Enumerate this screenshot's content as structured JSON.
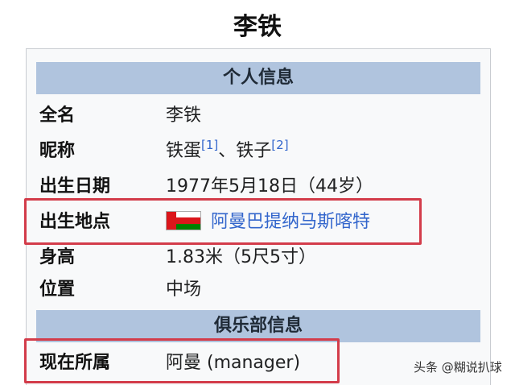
{
  "page": {
    "title": "李铁"
  },
  "infobox": {
    "personal_header": "个人信息",
    "club_header": "俱乐部信息",
    "rows": [
      {
        "label": "全名",
        "value": "李铁"
      },
      {
        "label": "昵称",
        "value_a": "铁蛋",
        "ref_a": "[1]",
        "sep": "、",
        "value_b": "铁子",
        "ref_b": "[2]"
      },
      {
        "label": "出生日期",
        "value": "1977年5月18日（44岁）"
      },
      {
        "label": "出生地点",
        "value": "阿曼巴提纳马斯喀特",
        "flag_icon": "oman-flag-icon"
      },
      {
        "label": "身高",
        "value": "1.83米（5尺5寸）"
      },
      {
        "label": "位置",
        "value": "中场"
      },
      {
        "label": "现在所属",
        "value": "阿曼 (manager)"
      }
    ]
  },
  "colors": {
    "section_header_bg": "#b0c4de",
    "infobox_bg": "#f8f9fa",
    "highlight_border": "#d33c4a",
    "link": "#3366cc"
  },
  "watermark": {
    "text": "头条 @糊说扒球"
  }
}
